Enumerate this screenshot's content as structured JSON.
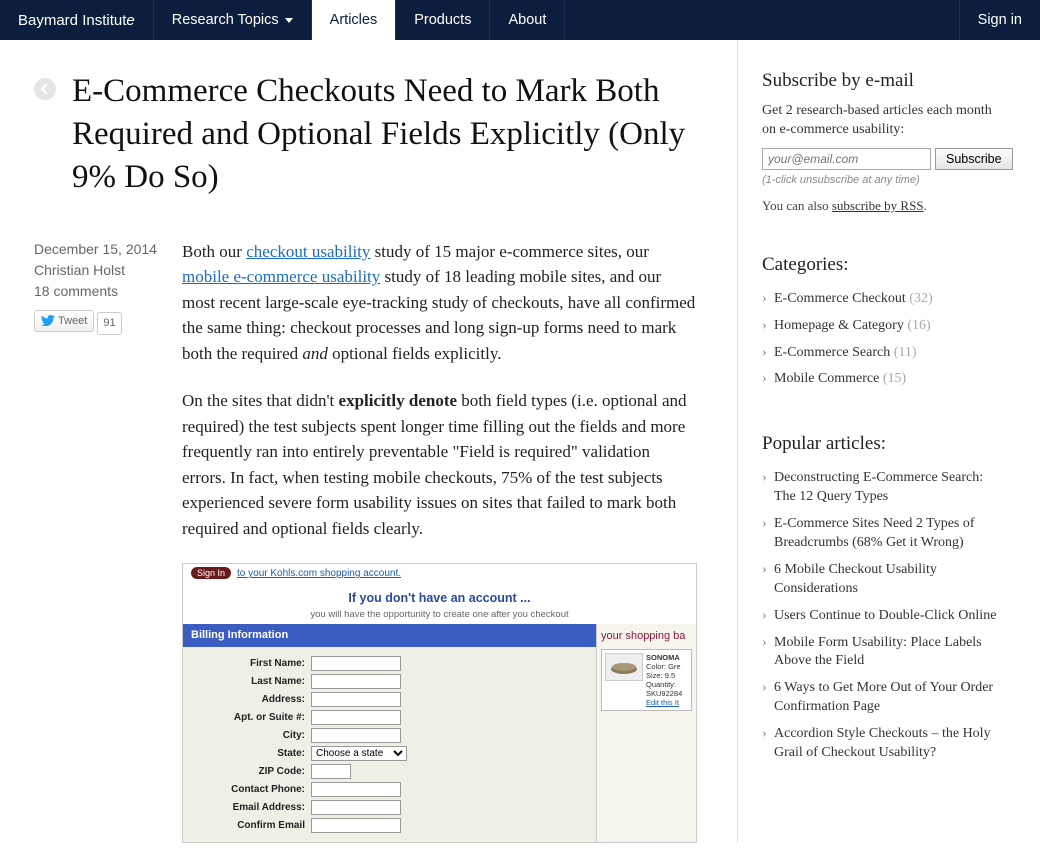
{
  "nav": {
    "brand": "Baymard Institute",
    "items": [
      "Research Topics",
      "Articles",
      "Products",
      "About"
    ],
    "signin": "Sign in"
  },
  "article": {
    "title": "E-Commerce Checkouts Need to Mark Both Required and Optional Fields Explicitly (Only 9% Do So)",
    "date": "December 15, 2014",
    "author": "Christian Holst",
    "comments": "18 comments",
    "tweet_label": "Tweet",
    "tweet_count": "91",
    "p1a": "Both our ",
    "p1_link1": "checkout usability",
    "p1b": " study of 15 major e-commerce sites, our ",
    "p1_link2": "mobile e-commerce usability",
    "p1c": " study of 18 leading mobile sites, and our most recent large-scale eye-tracking study of checkouts, have all confirmed the same thing: checkout processes and long sign-up forms need to mark both the required ",
    "p1_em": "and",
    "p1d": " optional fields explicitly.",
    "p2a": "On the sites that didn't ",
    "p2_strong": "explicitly denote",
    "p2b": " both field types (i.e. optional and required) the test subjects spent longer time filling out the fields and more frequently ran into entirely preventable \"Field is required\" validation errors. In fact, when testing mobile checkouts, 75% of the test subjects experienced severe form usability issues on sites that failed to mark both required and optional fields clearly."
  },
  "shot": {
    "signin_btn": "Sign In",
    "signin_text": "to your Kohls.com shopping account.",
    "acc_t1": "If you don't have an account ...",
    "acc_t2": "you will have the opportunity to create one after you checkout",
    "billing_hdr": "Billing Information",
    "fields": [
      "First Name:",
      "Last Name:",
      "Address:",
      "Apt. or Suite #:",
      "City:",
      "State:",
      "ZIP Code:",
      "Contact Phone:",
      "Email Address:",
      "Confirm Email"
    ],
    "state_opt": "Choose a state",
    "cart_title": "your shopping ba",
    "prod": {
      "name": "SONOMA",
      "l1": "Color: Gre",
      "l2": "Size: 9.5",
      "l3": "Quantity:",
      "l4": "SKU92284",
      "edit": "Edit this It"
    }
  },
  "sidebar": {
    "sub_h": "Subscribe by e-mail",
    "sub_p": "Get 2 research-based articles each month on e-commerce usability:",
    "sub_placeholder": "your@email.com",
    "sub_btn": "Subscribe",
    "sub_note": "(1-click unsubscribe at any time)",
    "sub_rss_a": "You can also ",
    "sub_rss_link": "subscribe by RSS",
    "cat_h": "Categories:",
    "cats": [
      {
        "label": "E-Commerce Checkout",
        "count": "(32)"
      },
      {
        "label": "Homepage & Category",
        "count": "(16)"
      },
      {
        "label": "E-Commerce Search",
        "count": "(11)"
      },
      {
        "label": "Mobile Commerce",
        "count": "(15)"
      }
    ],
    "pop_h": "Popular articles:",
    "pops": [
      "Deconstructing E-Commerce Search: The 12 Query Types",
      "E-Commerce Sites Need 2 Types of Breadcrumbs (68% Get it Wrong)",
      "6 Mobile Checkout Usability Considerations",
      "Users Continue to Double-Click Online",
      "Mobile Form Usability: Place Labels Above the Field",
      "6 Ways to Get More Out of Your Order Confirmation Page",
      "Accordion Style Checkouts – the Holy Grail of Checkout Usability?"
    ]
  }
}
